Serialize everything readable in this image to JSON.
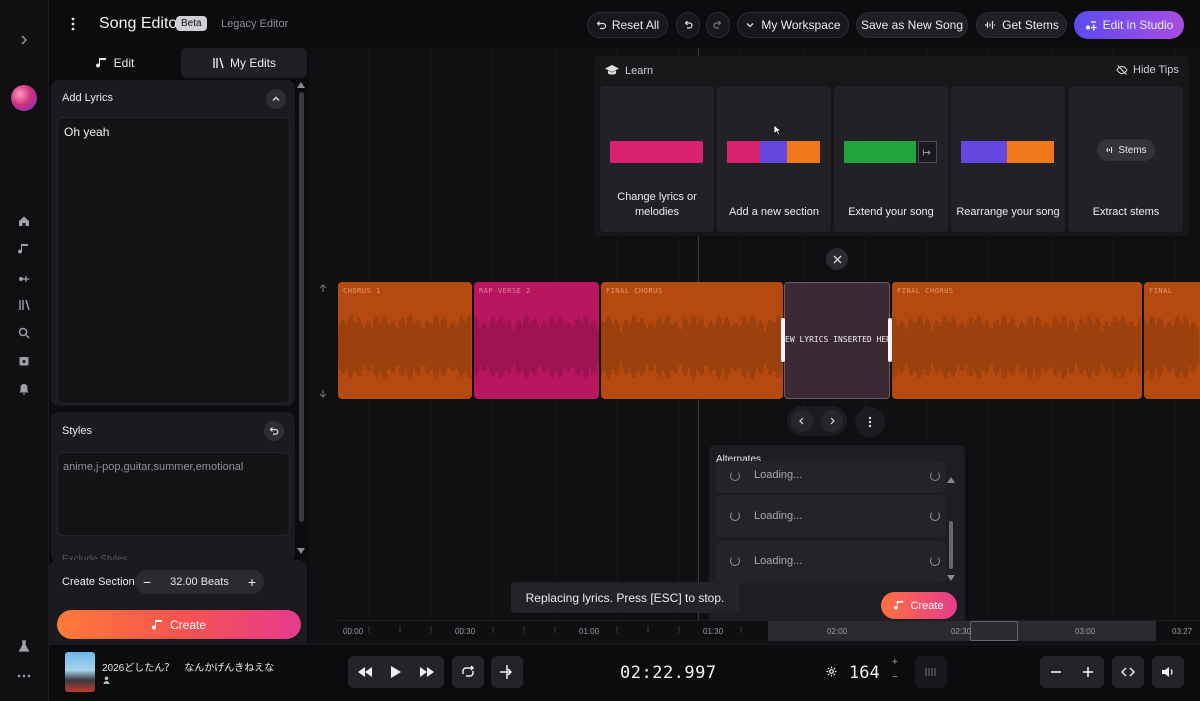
{
  "header": {
    "title": "Song Editor",
    "beta_badge": "Beta",
    "legacy_link": "Legacy Editor",
    "reset_label": "Reset All",
    "workspace_label": "My Workspace",
    "save_new_label": "Save as New Song",
    "get_stems_label": "Get Stems",
    "edit_studio_label": "Edit in Studio"
  },
  "left_panel": {
    "tabs": [
      {
        "label": "Edit",
        "icon": "music-note-icon"
      },
      {
        "label": "My Edits",
        "icon": "library-icon"
      }
    ],
    "lyrics": {
      "header": "Add Lyrics",
      "value": "Oh yeah"
    },
    "styles": {
      "header": "Styles",
      "value": "anime,j-pop,guitar,summer,emotional"
    },
    "exclude_partial": "Exclude Styles",
    "create_section": {
      "label": "Create Section",
      "beats": "32.00 Beats"
    },
    "create_label": "Create"
  },
  "learn": {
    "title": "Learn",
    "hide_tips": "Hide Tips",
    "cards": [
      {
        "label": "Change lyrics or melodies"
      },
      {
        "label": "Add a new section"
      },
      {
        "label": "Extend your song"
      },
      {
        "label": "Rearrange your song"
      },
      {
        "label": "Extract stems",
        "chip": "Stems"
      }
    ]
  },
  "timeline": {
    "sections": [
      {
        "name": "CHORUS 1",
        "color": "#b54a10"
      },
      {
        "name": "RAP VERSE 2",
        "color": "#b8175f"
      },
      {
        "name": "FINAL CHORUS",
        "color": "#b54a10"
      },
      {
        "name": "NEW LYRICS INSERTED HERE",
        "color": "#3b2a33"
      },
      {
        "name": "FINAL CHORUS",
        "color": "#b54a10"
      },
      {
        "name": "FINAL",
        "color": "#b54a10"
      }
    ],
    "time_labels": [
      "00:00",
      "00:30",
      "01:00",
      "01:30",
      "02:00",
      "02:30",
      "03:00",
      "03:27"
    ]
  },
  "alternates": {
    "title": "Alternates",
    "items": [
      "Loading...",
      "Loading...",
      "Loading..."
    ],
    "create_label": "Create"
  },
  "toast": "Replacing lyrics. Press [ESC] to stop.",
  "player": {
    "song_title": "2026どしたん？　なんかげんきねえな",
    "time": "02:22.997",
    "bpm": "164",
    "bpm_plus": "+",
    "bpm_minus": "−"
  },
  "colors": {
    "accent_gradient_start": "#ff6a3d",
    "accent_gradient_end": "#e83a8c",
    "studio_gradient_start": "#5a4cf0",
    "studio_gradient_end": "#a94de0",
    "orange_section": "#b54a10",
    "pink_section": "#b8175f"
  }
}
